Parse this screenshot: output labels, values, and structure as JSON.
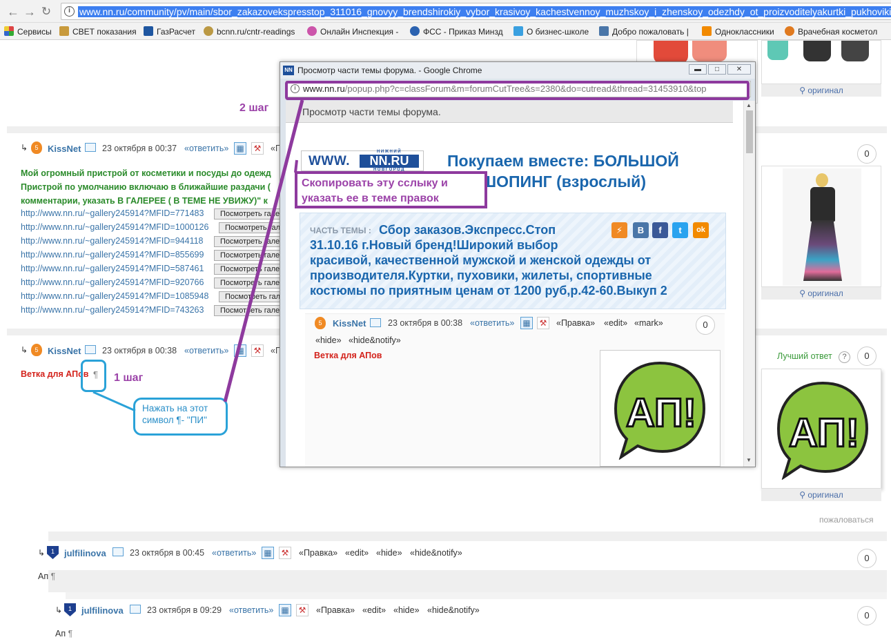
{
  "browser": {
    "url": "www.nn.ru/community/pv/main/sbor_zakazovekspresstop_311016_gnovyy_brendshirokiy_vybor_krasivoy_kachestvennoy_muzhskoy_i_zhenskoy_odezhdy_ot_proizvoditelyakurtki_pukhoviki_zh",
    "info_glyph": "i",
    "bookmarks": [
      {
        "label": "Сервисы",
        "icon": "apps-grid-icon",
        "color": "#d44"
      },
      {
        "label": "СВЕТ показания",
        "icon": "doc-icon",
        "color": "#c89a3c"
      },
      {
        "label": "ГазРасчет",
        "icon": "gas-icon",
        "color": "#1e56a0"
      },
      {
        "label": "bcnn.ru/cntr-readings",
        "icon": "flower-icon",
        "color": "#b94"
      },
      {
        "label": "Онлайн Инспекция -",
        "icon": "flower-icon",
        "color": "#c5a"
      },
      {
        "label": "ФСС - Приказ Минзд",
        "icon": "globe-icon",
        "color": "#2b62b0"
      },
      {
        "label": "О бизнес-школе",
        "icon": "bird-icon",
        "color": "#3aa0e0"
      },
      {
        "label": "Добро пожаловать |",
        "icon": "vk-icon",
        "color": "#4a76a8"
      },
      {
        "label": "Одноклассники",
        "icon": "ok-icon",
        "color": "#f28a00"
      },
      {
        "label": "Врачебная косметол",
        "icon": "star-icon",
        "color": "#e07a1f"
      }
    ]
  },
  "step2_label": "2 шаг",
  "step1_label": "1 шаг",
  "post1": {
    "author": "KissNet",
    "date": "23 октября в 00:37",
    "reply": "«ответить»",
    "trunc": "«П",
    "text_lines": [
      "Мой огромный пристрой от косметики и посуды до одежд",
      "Пристрой по умолчанию включаю в ближайшие раздачи (",
      "комментарии, указать В ГАЛЕРЕЕ ( В ТЕМЕ НЕ УВИЖУ)\" к"
    ],
    "links": [
      "http://www.nn.ru/~gallery245914?MFID=771483",
      "http://www.nn.ru/~gallery245914?MFID=1000126",
      "http://www.nn.ru/~gallery245914?MFID=944118",
      "http://www.nn.ru/~gallery245914?MFID=855699",
      "http://www.nn.ru/~gallery245914?MFID=587461",
      "http://www.nn.ru/~gallery245914?MFID=920766",
      "http://www.nn.ru/~gallery245914?MFID=1085948",
      "http://www.nn.ru/~gallery245914?MFID=743263"
    ],
    "view_btn": "Посмотреть гале",
    "count": "0"
  },
  "post2": {
    "author": "KissNet",
    "date": "23 октября в 00:38",
    "reply": "«ответить»",
    "trunc": "«П",
    "text": "Ветка для АПов",
    "pilcrow": "¶",
    "best_answer": "Лучший ответ",
    "help": "?",
    "count": "0"
  },
  "callout_step1": "Нажать на этот символ  ¶-  \"ПИ\"",
  "callout_copy": "Скопировать эту сслыку и указать ее в теме правок",
  "original_label": "оригинал",
  "report": "пожаловаться",
  "reply1": {
    "author": "julfilinova",
    "date": "23 октября в 00:45",
    "reply": "«ответить»",
    "actions": [
      "«Правка»",
      "«edit»",
      "«hide»",
      "«hide&notify»"
    ],
    "text": "Ап",
    "pilcrow": "¶",
    "count": "0"
  },
  "reply2": {
    "author": "julfilinova",
    "date": "23 октября в 09:29",
    "reply": "«ответить»",
    "actions": [
      "«Правка»",
      "«edit»",
      "«hide»",
      "«hide&notify»"
    ],
    "text": "Ап",
    "pilcrow": "¶",
    "count": "0"
  },
  "popup": {
    "window_title": "Просмотр части темы форума. - Google Chrome",
    "url_domain": "www.nn.ru",
    "url_path": "/popup.php?c=classForum&m=forumCutTree&s=2380&do=cutread&thread=31453910&top",
    "header": "Просмотр части темы форума.",
    "logo_www": "WWW.",
    "logo_nn": "NN.RU",
    "logo_small_top": "НИЖНИЙ",
    "logo_small_bottom": "НОВГОРОД",
    "forum_title_l1": "Покупаем вместе: БОЛЬШОЙ",
    "forum_title_l2": "ШОПИНГ (взрослый)",
    "part_label": "ЧАСТЬ ТЕМЫ :",
    "topic_lines": [
      "Сбор заказов.Экспресс.Стоп",
      "31.10.16 г.Новый бренд!Широкий выбор",
      "красивой, качественной мужской и женской одежды от",
      "производителя.Куртки, пуховики, жилеты, спортивные",
      "костюмы по приятным ценам от 1200 руб,р.42-60.Выкуп 2"
    ],
    "post": {
      "author": "KissNet",
      "date": "23 октября в 00:38",
      "reply": "«ответить»",
      "actions": [
        "«Правка»",
        "«edit»",
        "«mark»"
      ],
      "actions2": [
        "«hide»",
        "«hide&notify»"
      ],
      "text": "Ветка для АПов",
      "count": "0"
    },
    "social": [
      {
        "glyph": "⚡",
        "color": "#f08a24"
      },
      {
        "glyph": "В",
        "color": "#4a76a8"
      },
      {
        "glyph": "f",
        "color": "#3b5998"
      },
      {
        "glyph": "t",
        "color": "#2aa3ef"
      },
      {
        "glyph": "ok",
        "color": "#f28a00"
      }
    ]
  },
  "ap_logo_text": "АП!",
  "badge_kissnet": "5",
  "badge_jul": "1"
}
